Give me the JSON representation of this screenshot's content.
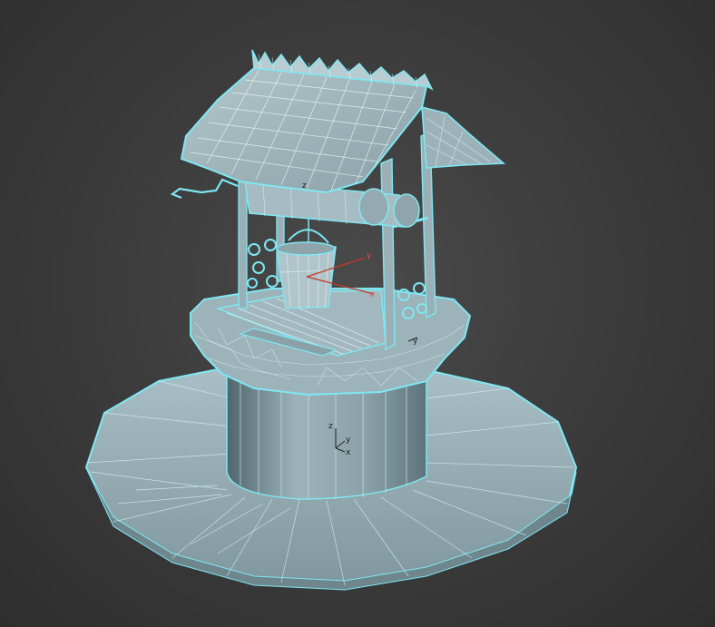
{
  "viewport": {
    "background": "#3a3a3a",
    "wire_color": "#7fe7f2",
    "surface_color": "#8fa8b0",
    "surface_dark": "#5f7a82"
  },
  "gizmos": {
    "roof_axis": {
      "z": "z"
    },
    "bucket_axis": {
      "y": "y",
      "x": "x",
      "y_color": "#c0392b",
      "x_color": "#c0392b"
    },
    "base_axis": {
      "z": "z",
      "y": "y",
      "x": "x"
    },
    "side_axis": {
      "y": "y"
    }
  }
}
